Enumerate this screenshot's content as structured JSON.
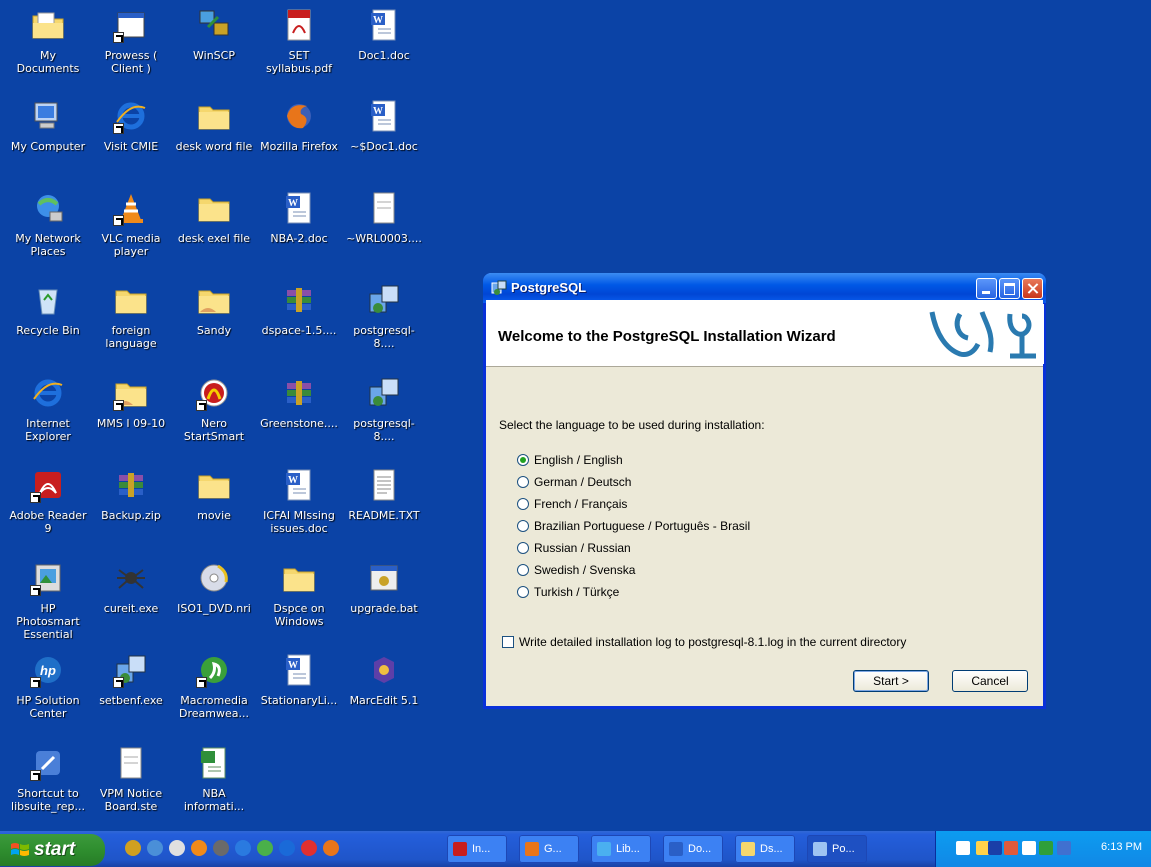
{
  "desktop": {
    "icons": [
      {
        "label": "My Documents",
        "icon": "folder-documents-icon"
      },
      {
        "label": "Prowess ( Client )",
        "icon": "app-window-icon"
      },
      {
        "label": "WinSCP",
        "icon": "winscp-icon"
      },
      {
        "label": "SET syllabus.pdf",
        "icon": "pdf-icon"
      },
      {
        "label": "Doc1.doc",
        "icon": "word-doc-icon"
      },
      {
        "label": "My Computer",
        "icon": "computer-icon"
      },
      {
        "label": "Visit CMIE",
        "icon": "ie-icon"
      },
      {
        "label": "desk word file",
        "icon": "folder-icon"
      },
      {
        "label": "Mozilla Firefox",
        "icon": "firefox-icon"
      },
      {
        "label": "~$Doc1.doc",
        "icon": "word-doc-icon"
      },
      {
        "label": "My Network Places",
        "icon": "network-icon"
      },
      {
        "label": "VLC media player",
        "icon": "vlc-icon"
      },
      {
        "label": "desk exel file",
        "icon": "folder-icon"
      },
      {
        "label": "NBA-2.doc",
        "icon": "word-doc-icon"
      },
      {
        "label": "~WRL0003....",
        "icon": "file-icon"
      },
      {
        "label": "Recycle Bin",
        "icon": "recycle-bin-icon"
      },
      {
        "label": "foreign language",
        "icon": "folder-icon"
      },
      {
        "label": "Sandy",
        "icon": "shared-folder-icon"
      },
      {
        "label": "dspace-1.5....",
        "icon": "winrar-icon"
      },
      {
        "label": "postgresql-8....",
        "icon": "installer-icon"
      },
      {
        "label": "Internet Explorer",
        "icon": "ie-icon"
      },
      {
        "label": "MMS I 09-10",
        "icon": "shared-folder-icon"
      },
      {
        "label": "Nero StartSmart",
        "icon": "nero-icon"
      },
      {
        "label": "Greenstone....",
        "icon": "winrar-icon"
      },
      {
        "label": "postgresql-8....",
        "icon": "installer-icon"
      },
      {
        "label": "Adobe Reader 9",
        "icon": "adobe-reader-icon"
      },
      {
        "label": "Backup.zip",
        "icon": "winrar-icon"
      },
      {
        "label": "movie",
        "icon": "folder-icon"
      },
      {
        "label": "ICFAI MIssing issues.doc",
        "icon": "word-doc-icon"
      },
      {
        "label": "README.TXT",
        "icon": "text-file-icon"
      },
      {
        "label": "HP Photosmart Essential",
        "icon": "hp-photosmart-icon"
      },
      {
        "label": "cureit.exe",
        "icon": "spider-icon"
      },
      {
        "label": "ISO1_DVD.nri",
        "icon": "disc-icon"
      },
      {
        "label": "Dspce on Windows",
        "icon": "folder-icon"
      },
      {
        "label": "upgrade.bat",
        "icon": "batch-file-icon"
      },
      {
        "label": "HP Solution Center",
        "icon": "hp-icon"
      },
      {
        "label": "setbenf.exe",
        "icon": "installer-icon"
      },
      {
        "label": "Macromedia Dreamwea...",
        "icon": "dreamweaver-icon"
      },
      {
        "label": "StationaryLi...",
        "icon": "word-doc-icon"
      },
      {
        "label": "MarcEdit 5.1",
        "icon": "marcedit-icon"
      },
      {
        "label": "Shortcut to libsuite_rep...",
        "icon": "app-icon"
      },
      {
        "label": "VPM Notice Board.ste",
        "icon": "file-icon"
      },
      {
        "label": "NBA informati...",
        "icon": "excel-icon"
      }
    ]
  },
  "window": {
    "title": "PostgreSQL",
    "welcome": "Welcome to the PostgreSQL Installation Wizard",
    "prompt": "Select the language to be used during installation:",
    "languages": [
      "English / English",
      "German / Deutsch",
      "French / Français",
      "Brazilian Portuguese / Português - Brasil",
      "Russian / Russian",
      "Swedish / Svenska",
      "Turkish / Türkçe"
    ],
    "selected_language": "English / English",
    "log_checkbox_label": "Write detailed installation log to postgresql-8.1.log in the current directory",
    "log_checked": false,
    "start_label": "Start >",
    "cancel_label": "Cancel"
  },
  "taskbar": {
    "start_label": "start",
    "tasks": [
      {
        "label": "In...",
        "icon": "pdf-icon",
        "active": false
      },
      {
        "label": "G...",
        "icon": "firefox-icon",
        "active": false
      },
      {
        "label": "Lib...",
        "icon": "ie-icon",
        "active": false
      },
      {
        "label": "Do...",
        "icon": "word-doc-icon",
        "active": false
      },
      {
        "label": "Ds...",
        "icon": "folder-icon",
        "active": false
      },
      {
        "label": "Po...",
        "icon": "installer-icon",
        "active": true
      }
    ],
    "clock": "6:13 PM"
  },
  "colors": {
    "desktop": "#0b43a6",
    "titlebar": "#0058e6",
    "start": "#2f8e2f"
  }
}
